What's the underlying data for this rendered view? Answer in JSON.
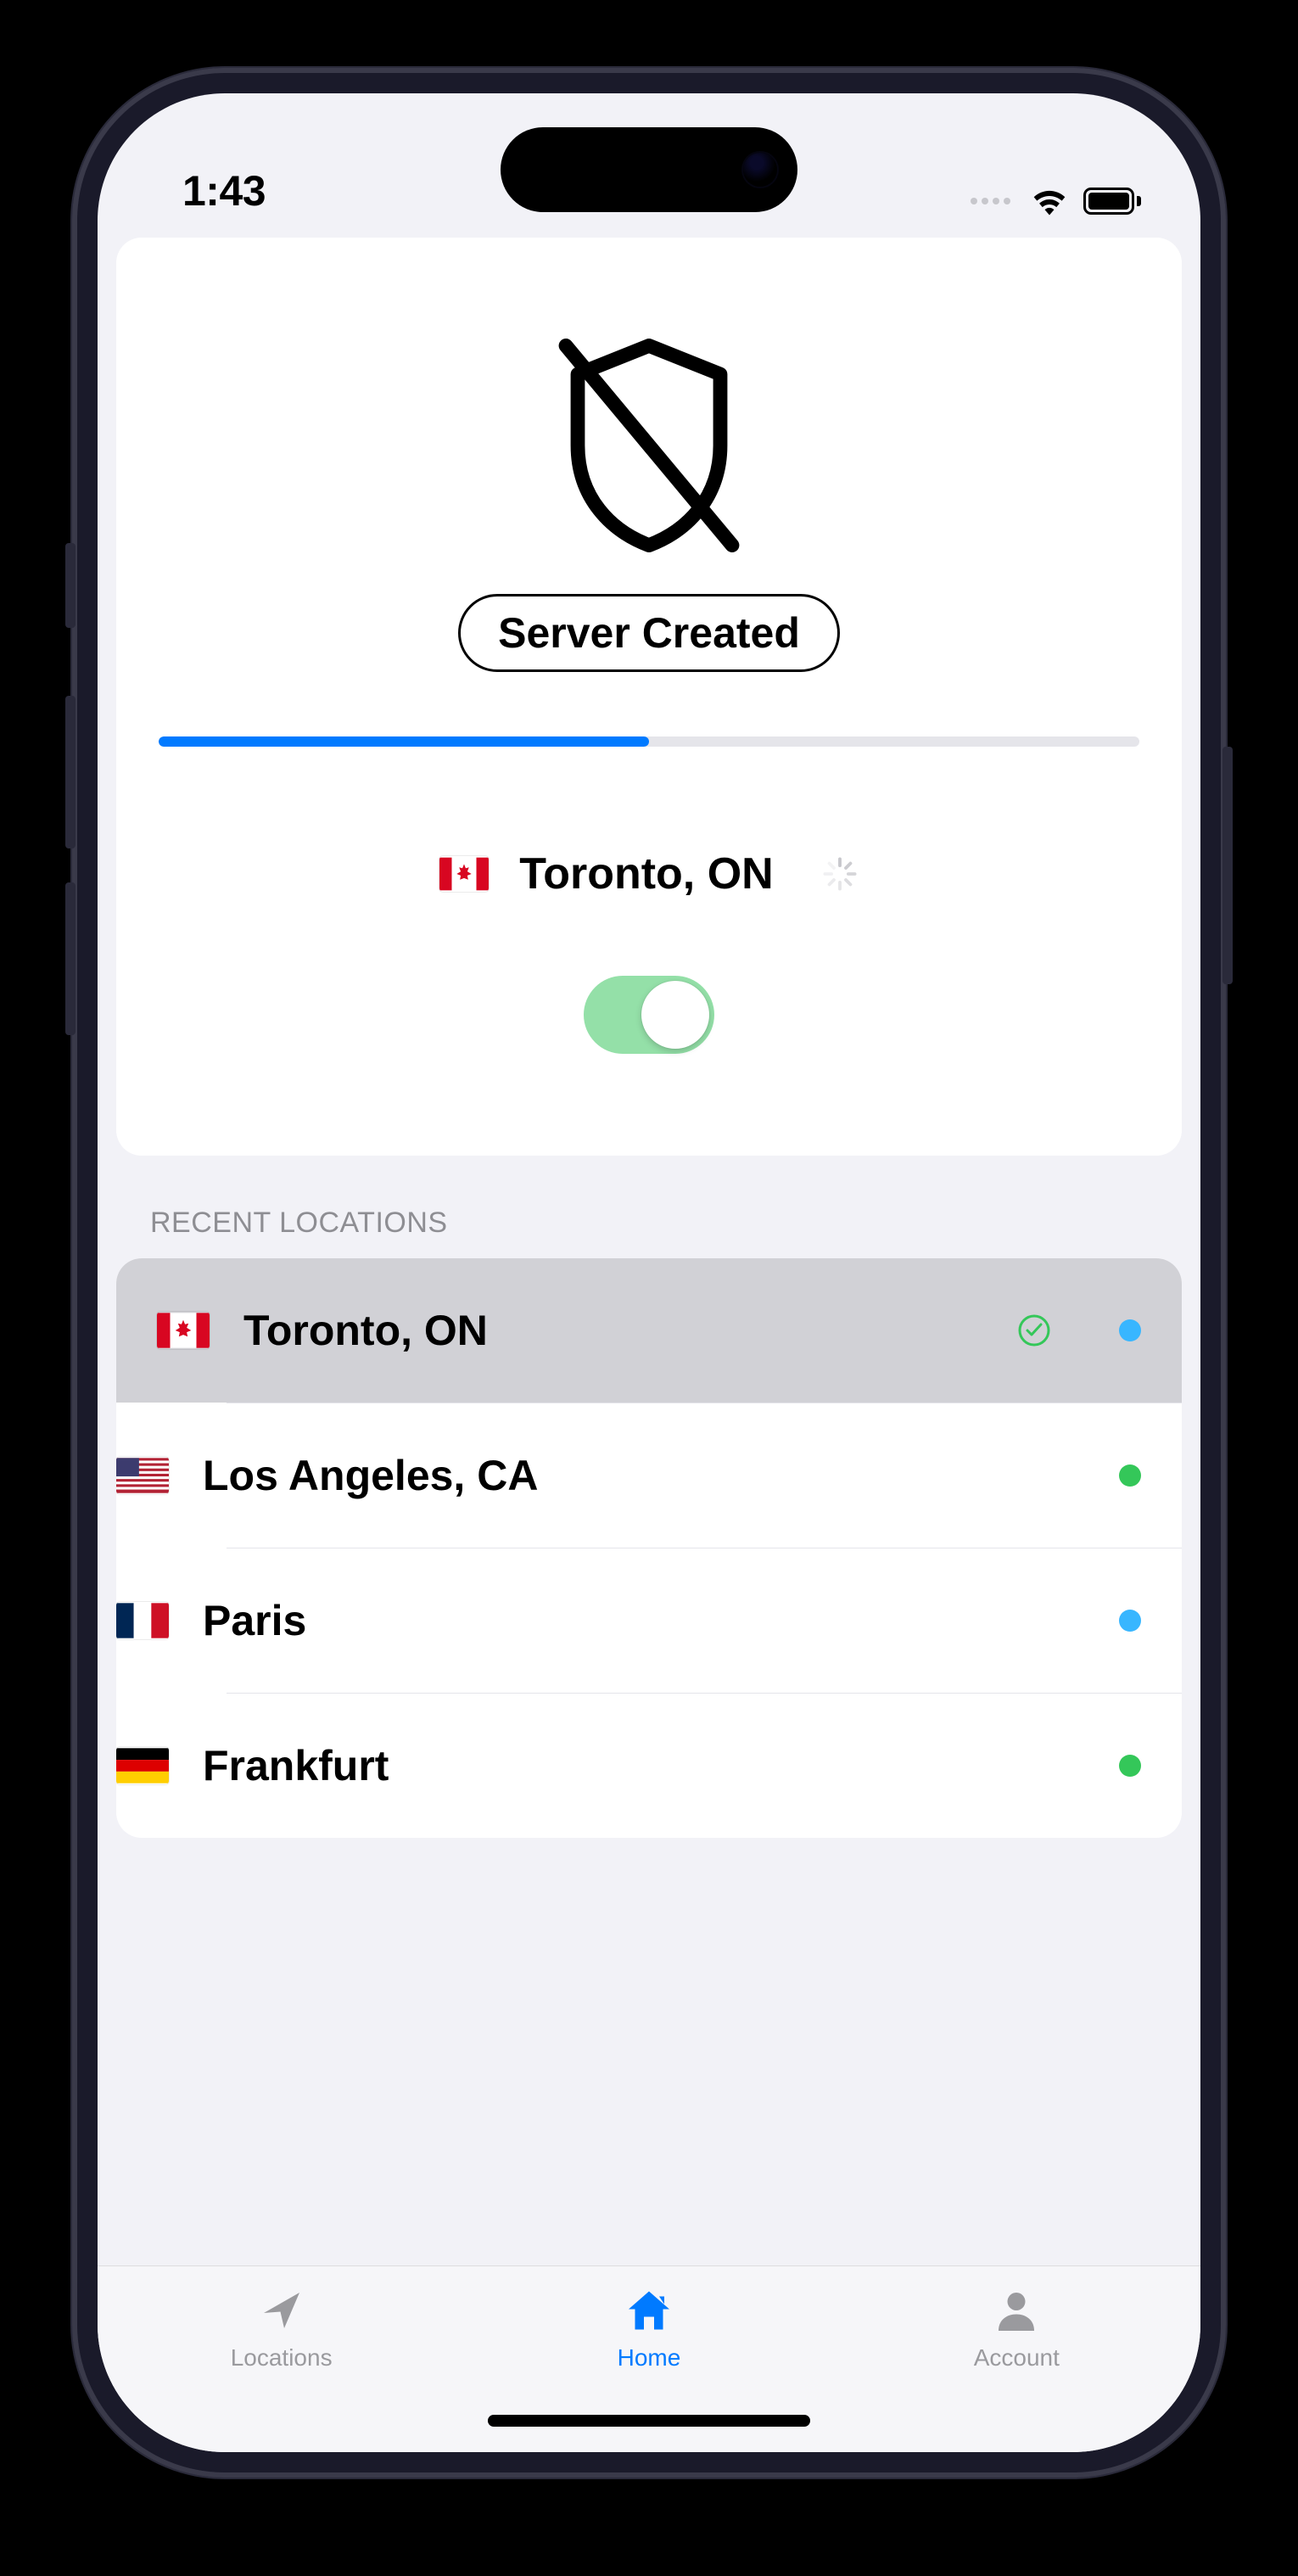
{
  "status_bar": {
    "time": "1:43"
  },
  "main": {
    "status_label": "Server Created",
    "progress_percent": 50,
    "current_location": {
      "flag": "ca",
      "name": "Toronto, ON"
    },
    "toggle_on": true
  },
  "recent": {
    "header": "RECENT LOCATIONS",
    "items": [
      {
        "flag": "ca",
        "name": "Toronto, ON",
        "selected": true,
        "dot": "blue"
      },
      {
        "flag": "us",
        "name": "Los Angeles, CA",
        "selected": false,
        "dot": "green"
      },
      {
        "flag": "fr",
        "name": "Paris",
        "selected": false,
        "dot": "blue"
      },
      {
        "flag": "de",
        "name": "Frankfurt",
        "selected": false,
        "dot": "green"
      }
    ]
  },
  "tabs": {
    "locations": "Locations",
    "home": "Home",
    "account": "Account"
  }
}
